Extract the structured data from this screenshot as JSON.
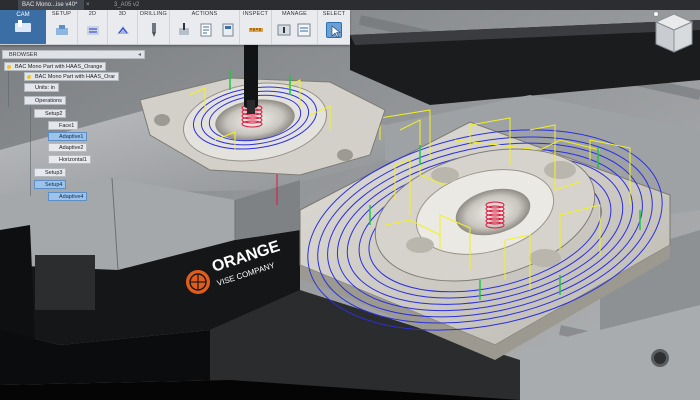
{
  "window": {
    "tabs": [
      {
        "label": "BAC Mono...ise v40*",
        "active": true
      },
      {
        "label": "3_A05 v2",
        "active": false
      }
    ]
  },
  "ribbon": {
    "workspace": "CAM",
    "groups": [
      "SETUP",
      "2D",
      "3D",
      "DRILLING",
      "ACTIONS",
      "INSPECT",
      "MANAGE",
      "SELECT"
    ]
  },
  "browser": {
    "title": "BROWSER",
    "nodes": {
      "root": "BAC Mono Part with HAAS_Orange",
      "sub": "BAC Mono Part with HAAS_Orar",
      "units": "Units: in",
      "operations": "Operations",
      "setup2": "Setup2",
      "face1": "Face1",
      "adaptive1": "Adaptive1",
      "adaptive2": "Adaptive2",
      "horizontal1": "Horizontal1",
      "setup3": "Setup3",
      "setup4": "Setup4",
      "adaptive4": "Adaptive4"
    }
  },
  "brand": {
    "line1": "ORANGE",
    "line2": "VISE COMPANY",
    "color": "#e25d1c"
  },
  "colors": {
    "toolpath_blue": "#2b2fe0",
    "toolpath_yellow": "#f2f21e",
    "toolpath_green": "#1ec64a",
    "toolpath_red": "#e0143c",
    "part_metal": "#d9d6d0",
    "vise_body": "#151617",
    "vise_top": "#9a9d9f"
  }
}
